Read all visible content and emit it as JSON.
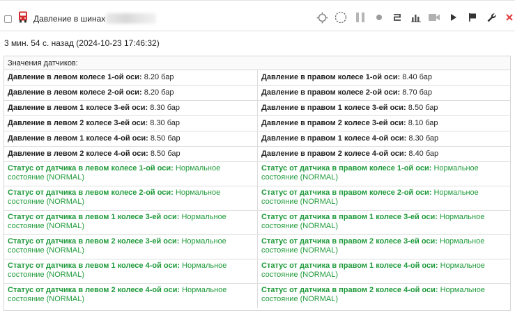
{
  "header": {
    "title": "Давление в шинах",
    "colors": {
      "icon_red": "#d22c2c",
      "close_red": "#e23d3d",
      "toolbar_gray": "#7a7a7a"
    },
    "toolbar_icons": [
      "crosshair-icon",
      "dashed-circle-icon",
      "pause-icon",
      "dot-icon",
      "link-icon",
      "bar-chart-icon",
      "video-icon",
      "play-icon",
      "flag-icon",
      "wrench-icon",
      "close-icon"
    ]
  },
  "timeline": "3 мин. 54 с. назад (2024-10-23 17:46:32)",
  "panel": {
    "heading": "Значения датчиков:",
    "pressure_rows": [
      {
        "left_label": "Давление в левом колесе 1-ой оси:",
        "left_value": "8.20 бар",
        "right_label": "Давление в правом колесе 1-ой оси:",
        "right_value": "8.40 бар"
      },
      {
        "left_label": "Давление в левом колесе 2-ой оси:",
        "left_value": "8.20 бар",
        "right_label": "Давление в правом колесе 2-ой оси:",
        "right_value": "8.70 бар"
      },
      {
        "left_label": "Давление в левом 1 колесе 3-ей оси:",
        "left_value": "8.30 бар",
        "right_label": "Давление в правом 1 колесе 3-ей оси:",
        "right_value": "8.50 бар"
      },
      {
        "left_label": "Давление в левом 2 колесе 3-ей оси:",
        "left_value": "8.30 бар",
        "right_label": "Давление в правом 2 колесе 3-ей оси:",
        "right_value": "8.10 бар"
      },
      {
        "left_label": "Давление в левом 1 колесе 4-ой оси:",
        "left_value": "8.50 бар",
        "right_label": "Давление в правом 1 колесе 4-ой оси:",
        "right_value": "8.30 бар"
      },
      {
        "left_label": "Давление в левом 2 колесе 4-ой оси:",
        "left_value": "8.50 бар",
        "right_label": "Давление в правом 2 колесе 4-ой оси:",
        "right_value": "8.40 бар"
      }
    ],
    "status_rows": [
      {
        "left_label": "Статус от датчика в левом колесе 1-ой оси:",
        "right_label": "Статус от датчика в правом колесе 1-ой оси:"
      },
      {
        "left_label": "Статус от датчика в левом колесе 2-ой оси:",
        "right_label": "Статус от датчика в правом колесе 2-ой оси:"
      },
      {
        "left_label": "Статус от датчика в левом 1 колесе 3-ей оси:",
        "right_label": "Статус от датчика в правом 1 колесе 3-ей оси:"
      },
      {
        "left_label": "Статус от датчика в левом 2 колесе 3-ей оси:",
        "right_label": "Статус от датчика в правом 2 колесе 3-ей оси:"
      },
      {
        "left_label": "Статус от датчика в левом 1 колесе 4-ой оси:",
        "right_label": "Статус от датчика в правом 1 колесе 4-ой оси:"
      },
      {
        "left_label": "Статус от датчика в левом 2 колесе 4-ой оси:",
        "right_label": "Статус от датчика в правом 2 колесе 4-ой оси:"
      }
    ],
    "status_value_line1": "Нормальное",
    "status_value_line2": "состояние (NORMAL)",
    "status_color": "#1e9a3a"
  }
}
